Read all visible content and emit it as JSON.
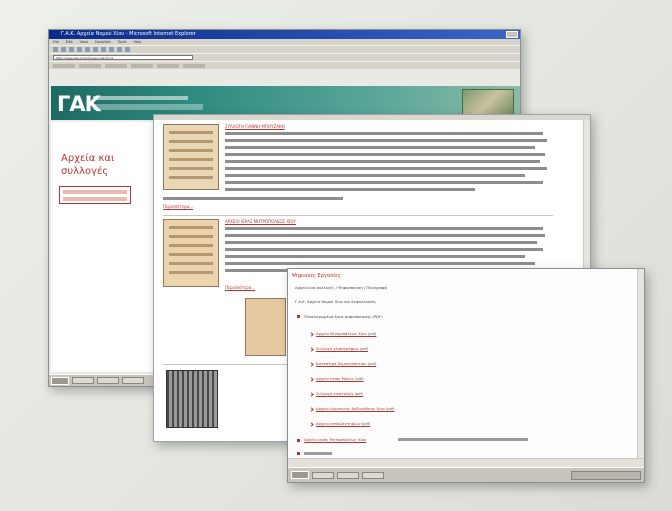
{
  "browser_main": {
    "title": "Γ.Α.Κ. Αρχεία Νομού Χίου - Microsoft Internet Explorer",
    "menu": [
      "File",
      "Edit",
      "View",
      "Favorites",
      "Tools",
      "Help"
    ],
    "address": "http://www.gak.gr/archives/collections",
    "logo": "ΓΑΚ",
    "section_title": "Αρχεία και συλλογές"
  },
  "page": {
    "entries": [
      {
        "heading": "ΣΥΛΛΟΓΗ ΓΙΑΝΝΗ ΜΠΟΥΖΑΚΗ",
        "more": "Περισσότερα..."
      },
      {
        "heading": "ΑΡΧΕΙΟ ΙΕΡΑΣ ΜΗΤΡΟΠΟΛΕΩΣ ΧΙΟΥ",
        "more": "Περισσότερα..."
      }
    ]
  },
  "dialog": {
    "title": "Ψηφιακές Εργασίες",
    "intro": "Αρχεία και συλλογές / Ψηφιοποίηση / Περιγραφή",
    "note": "Γ.Α.Κ. Αρχεία Νομού Χίου και Κεφαλλονιάς",
    "list_heading": "Ολοκληρωμένα έργα ψηφιοποίησης (PDF)",
    "items": [
      "Αρχείο Μητροπόλεως Χίου",
      "Συλλογή χειρογράφων",
      "Κατάστιχα δημογεροντίας",
      "Αρχείο Ιεράς Μονής",
      "Συλλογή επιστολών",
      "Αρχείο Δημοτικής Βιβλιοθήκης Χίου",
      "Αρχείο εκπαιδευτηρίων"
    ],
    "pdf_tag": "(pdf)",
    "footer_link": "Αρχείο Ιεράς Μητροπόλεως Χίου"
  }
}
